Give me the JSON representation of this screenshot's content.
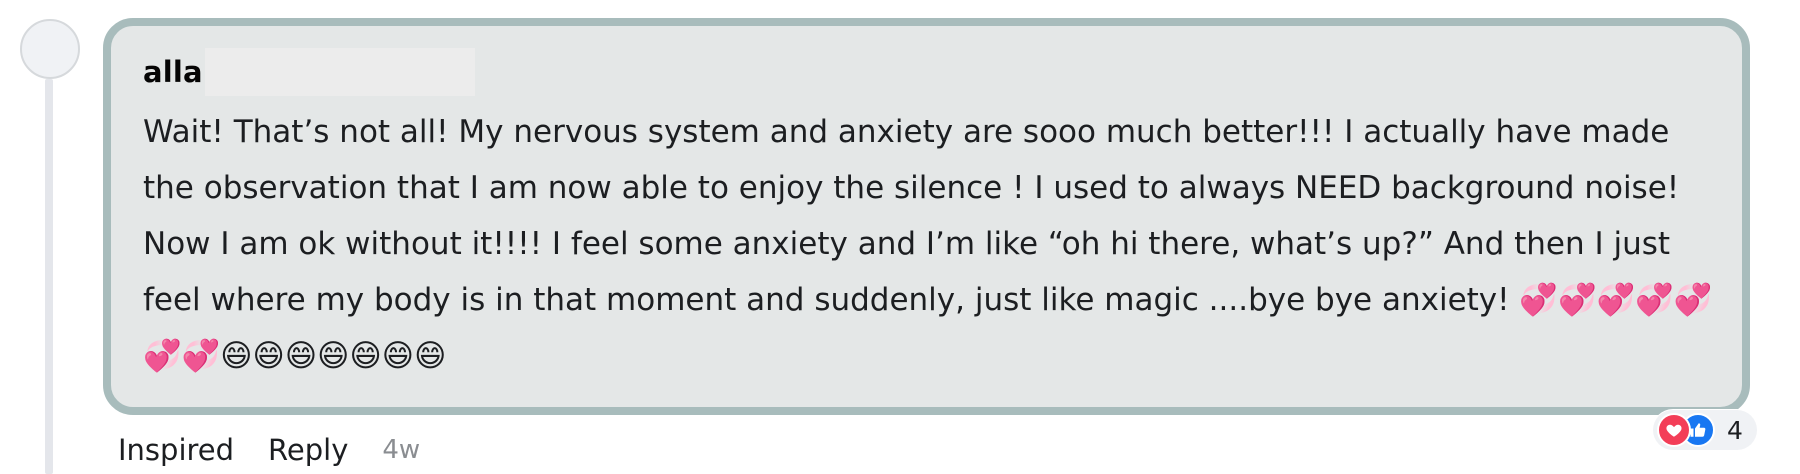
{
  "comment": {
    "author": "alla",
    "text": "Wait! That’s not all! My nervous system and anxiety are sooo much better!!! I actually have made the observation that I am now able to enjoy the silence ! I used to always NEED background noise! Now I am ok without it!!!! I feel some anxiety and I’m like “oh hi there, what’s up?” And then I just feel where my body is in that moment and suddenly, just like magic ....bye bye anxiety! 💞💞💞💞💞💞💞😄😄😄😄😄😄😄"
  },
  "actions": {
    "inspired_label": "Inspired",
    "reply_label": "Reply",
    "timestamp": "4w"
  },
  "reactions": {
    "icons": [
      "heart-icon",
      "like-icon"
    ],
    "count": "4"
  },
  "colors": {
    "bubble_bg": "#e4e7e7",
    "bubble_border": "#a8bcbc",
    "heart": "#f33e58",
    "like": "#1877f2"
  }
}
